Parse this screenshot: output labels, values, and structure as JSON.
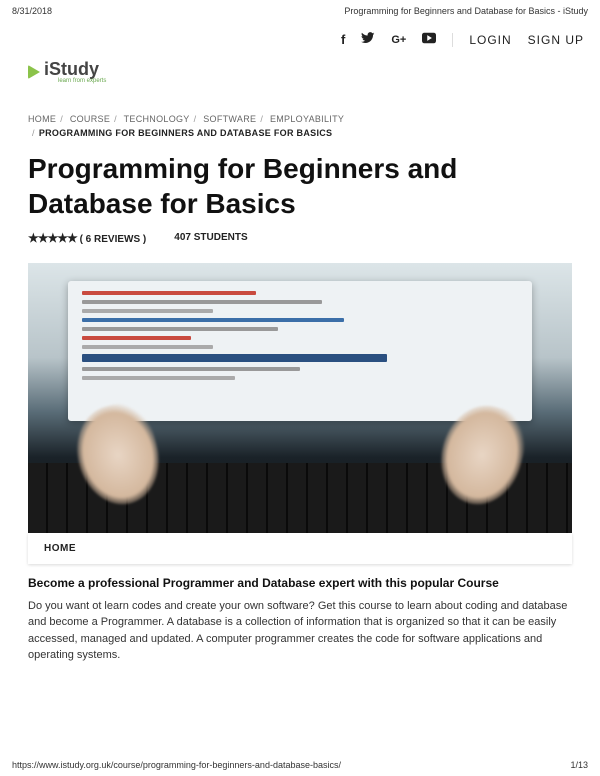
{
  "print": {
    "date": "8/31/2018",
    "title": "Programming for Beginners and Database for Basics - iStudy",
    "url": "https://www.istudy.org.uk/course/programming-for-beginners-and-database-basics/",
    "page": "1/13"
  },
  "header": {
    "login": "LOGIN",
    "signup": "SIGN UP",
    "logo_text": "iStudy",
    "logo_tag": "learn from experts"
  },
  "breadcrumb": {
    "items": [
      "HOME",
      "COURSE",
      "TECHNOLOGY",
      "SOFTWARE",
      "EMPLOYABILITY"
    ],
    "current": "PROGRAMMING FOR BEGINNERS AND DATABASE FOR BASICS"
  },
  "page": {
    "title": "Programming for Beginners and Database for Basics",
    "reviews": "( 6 REVIEWS )",
    "students": "407 STUDENTS",
    "tab": "HOME",
    "subhead": "Become a professional Programmer and Database expert with this popular Course",
    "body": "Do you want ot learn codes and create your own software? Get this course to learn about coding and database and become a Programmer. A database is a collection of information that is organized so that it can be easily accessed, managed and updated. A computer programmer creates the code for software applications and operating systems."
  }
}
